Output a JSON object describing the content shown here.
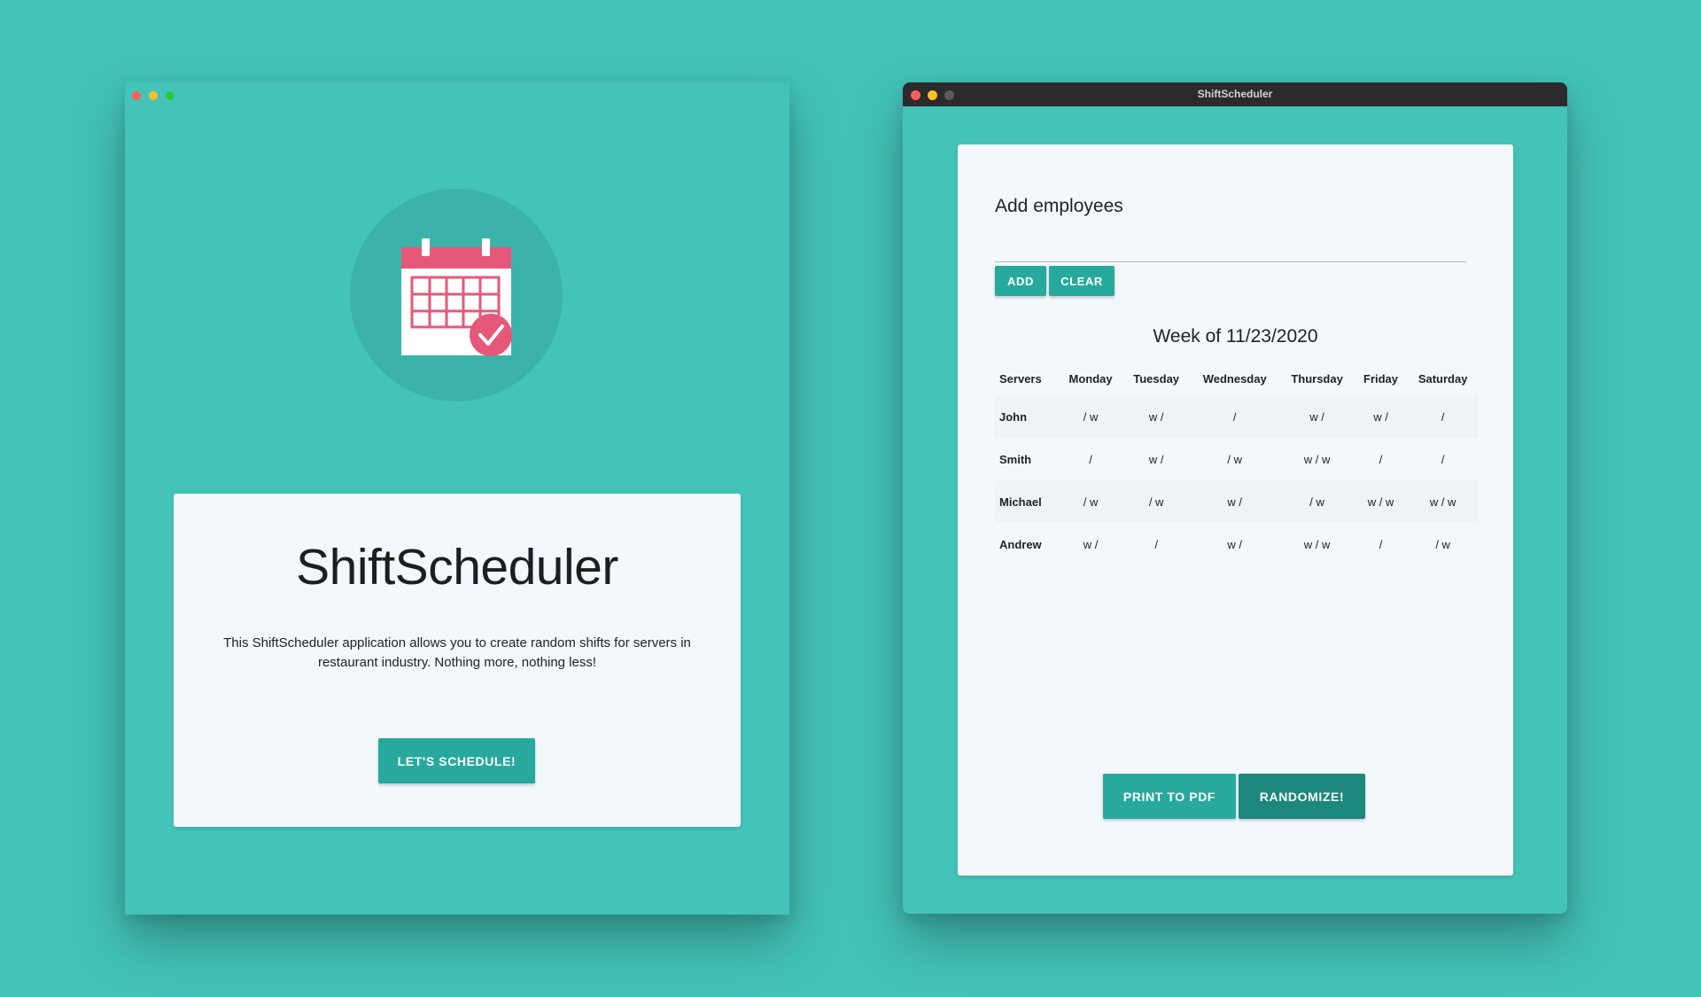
{
  "left_window": {
    "app_title": "ShiftScheduler",
    "description": "This ShiftScheduler application allows you to create random shifts for servers in restaurant industry. Nothing more, nothing less!",
    "schedule_button": "LET'S SCHEDULE!"
  },
  "right_window": {
    "window_title": "ShiftScheduler",
    "add_heading": "Add employees",
    "employee_input": {
      "value": "",
      "placeholder": ""
    },
    "add_button": "ADD",
    "clear_button": "CLEAR",
    "week_title": "Week of 11/23/2020",
    "table": {
      "headers": [
        "Servers",
        "Monday",
        "Tuesday",
        "Wednesday",
        "Thursday",
        "Friday",
        "Saturday"
      ],
      "rows": [
        {
          "name": "John",
          "cells": [
            "/ w",
            "w /",
            "/",
            "w /",
            "w /",
            "/"
          ]
        },
        {
          "name": "Smith",
          "cells": [
            "/",
            "w /",
            "/ w",
            "w / w",
            "/",
            "/"
          ]
        },
        {
          "name": "Michael",
          "cells": [
            "/ w",
            "/ w",
            "w /",
            "/ w",
            "w / w",
            "w / w"
          ]
        },
        {
          "name": "Andrew",
          "cells": [
            "w /",
            "/",
            "w /",
            "w / w",
            "/",
            "/ w"
          ]
        }
      ]
    },
    "print_button": "PRINT TO PDF",
    "randomize_button": "RANDOMIZE!"
  },
  "icons": {
    "calendar": "calendar-check-icon",
    "traffic_lights": [
      "close",
      "minimize",
      "zoom"
    ]
  },
  "colors": {
    "background": "#43c3b8",
    "accent": "#27a99e",
    "accent_dark": "#1c877d",
    "calendar_pink": "#e5587a",
    "card": "#f3f8fd"
  }
}
